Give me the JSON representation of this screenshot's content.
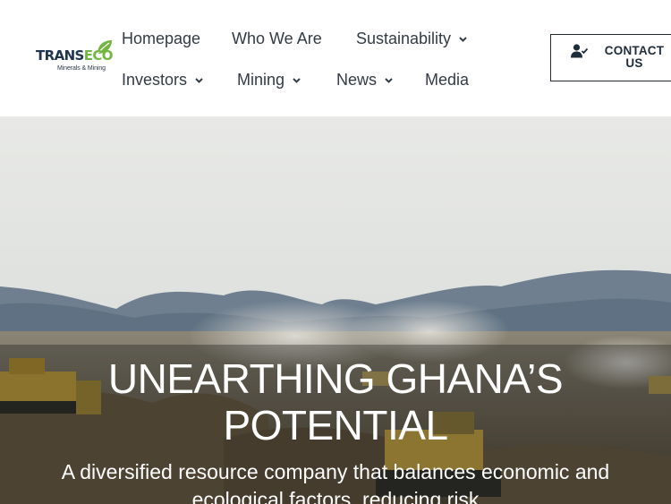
{
  "logo": {
    "word_part1": "TRANS",
    "word_part2": "ECO",
    "tagline": "Minerals & Mining",
    "colors": {
      "navy": "#1f3550",
      "green": "#73b642"
    }
  },
  "nav": {
    "items": [
      {
        "label": "Homepage",
        "has_dropdown": false
      },
      {
        "label": "Who We Are",
        "has_dropdown": false
      },
      {
        "label": "Sustainability",
        "has_dropdown": true
      },
      {
        "label": "Investors",
        "has_dropdown": true
      },
      {
        "label": "Mining",
        "has_dropdown": true
      },
      {
        "label": "News",
        "has_dropdown": true
      },
      {
        "label": "Media",
        "has_dropdown": false
      }
    ],
    "dropdown_icon": "chevron-down-icon"
  },
  "contact": {
    "line1": "CONTACT",
    "line2": "US",
    "icon": "user-check-icon"
  },
  "hero": {
    "title_line1": "UNEARTHING GHANA’S",
    "title_line2": "POTENTIAL",
    "subtitle_line1": "A diversified resource company that balances economic and",
    "subtitle_line2": "ecological factors, reducing risk",
    "background": "mining-site-photo"
  },
  "colors": {
    "nav_text": "#333b45",
    "button_border": "#222b33",
    "hero_text": "#ffffff"
  }
}
